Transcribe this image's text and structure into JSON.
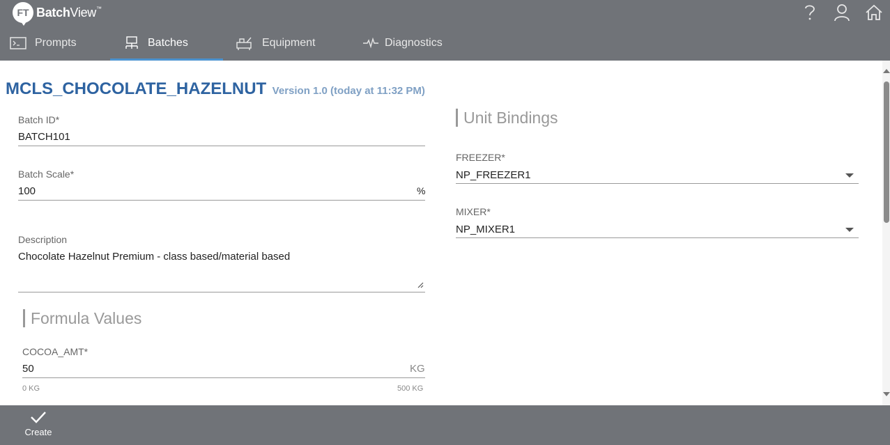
{
  "app": {
    "logo_badge": "FT",
    "name_bold": "Batch",
    "name_light": "View",
    "trademark": "™"
  },
  "header_icons": [
    "help-icon",
    "user-icon",
    "home-icon"
  ],
  "tabs": [
    {
      "label": "Prompts",
      "icon": "terminal-icon",
      "active": false
    },
    {
      "label": "Batches",
      "icon": "batches-icon",
      "active": true
    },
    {
      "label": "Equipment",
      "icon": "equipment-icon",
      "active": false
    },
    {
      "label": "Diagnostics",
      "icon": "pulse-icon",
      "active": false
    }
  ],
  "recipe": {
    "title": "MCLS_CHOCOLATE_HAZELNUT",
    "version": "Version 1.0 (today at 11:32 PM)"
  },
  "form": {
    "batch_id": {
      "label": "Batch ID*",
      "value": "BATCH101"
    },
    "batch_scale": {
      "label": "Batch Scale*",
      "value": "100",
      "unit": "%"
    },
    "description": {
      "label": "Description",
      "value": "Chocolate Hazelnut Premium - class based/material based"
    }
  },
  "formula": {
    "section_title": "Formula Values",
    "cocoa": {
      "label": "COCOA_AMT*",
      "value": "50",
      "unit": "KG",
      "min": "0 KG",
      "max": "500 KG"
    }
  },
  "bindings": {
    "section_title": "Unit Bindings",
    "freezer": {
      "label": "FREEZER*",
      "value": "NP_FREEZER1"
    },
    "mixer": {
      "label": "MIXER*",
      "value": "NP_MIXER1"
    }
  },
  "footer": {
    "create_label": "Create"
  },
  "colors": {
    "header_bg": "#707378",
    "title_blue": "#2e63a1",
    "version_blue": "#7fa0c4",
    "tab_underline": "#4b93d0"
  }
}
